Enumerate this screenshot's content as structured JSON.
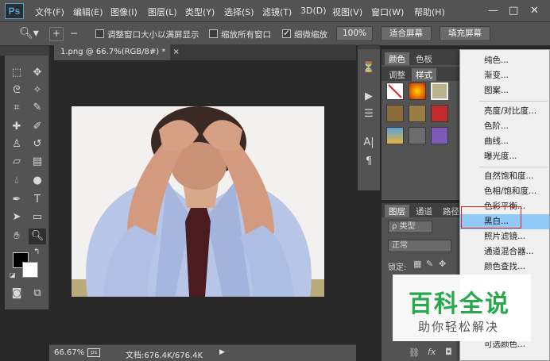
{
  "app": {
    "logo": "Ps"
  },
  "menubar": {
    "items": [
      "文件(F)",
      "编辑(E)",
      "图像(I)",
      "图层(L)",
      "类型(Y)",
      "选择(S)",
      "滤镜(T)",
      "3D(D)",
      "视图(V)",
      "窗口(W)",
      "帮助(H)"
    ],
    "window_buttons": [
      "—",
      "□",
      "✕"
    ]
  },
  "options": {
    "resize_windows_label": "调整窗口大小以满屏显示",
    "resize_windows_checked": false,
    "zoom_all_label": "缩放所有窗口",
    "zoom_all_checked": false,
    "scrubby_label": "细微缩放",
    "scrubby_checked": true,
    "btn_100": "100%",
    "btn_fit": "适合屏幕",
    "btn_fill": "填充屏幕"
  },
  "document": {
    "tab_title": "1.png @ 66.7%(RGB/8#) *",
    "tab_close": "×"
  },
  "status": {
    "zoom": "66.67%",
    "doc_size": "文档:676.4K/676.4K"
  },
  "panels": {
    "color_tabs": [
      "颜色",
      "色板"
    ],
    "adjust_tabs": [
      "调整",
      "样式"
    ],
    "layers_tabs": [
      "图层",
      "通道",
      "路径"
    ],
    "kind_label": "ρ 类型",
    "blend_mode": "正常",
    "lock_label": "锁定:",
    "bottom_icons": [
      "link-icon",
      "fx-icon",
      "mask-icon"
    ]
  },
  "dropdown": {
    "items": [
      "纯色...",
      "渐变...",
      "图案...",
      "亮度/对比度...",
      "色阶...",
      "曲线...",
      "曝光度...",
      "自然饱和度...",
      "色相/饱和度...",
      "色彩平衡...",
      "黑白...",
      "照片滤镜...",
      "通道混合器...",
      "颜色查找...",
      "可选颜色..."
    ],
    "highlighted": "黑白..."
  },
  "watermark": {
    "title": "百科全说",
    "subtitle": "助你轻松解决"
  },
  "colors": {
    "ui_dark": "#535353",
    "canvas_bg": "#282828",
    "accent": "#4aa3df",
    "highlight": "#91c9f7",
    "watermark_green": "#27a84a"
  }
}
